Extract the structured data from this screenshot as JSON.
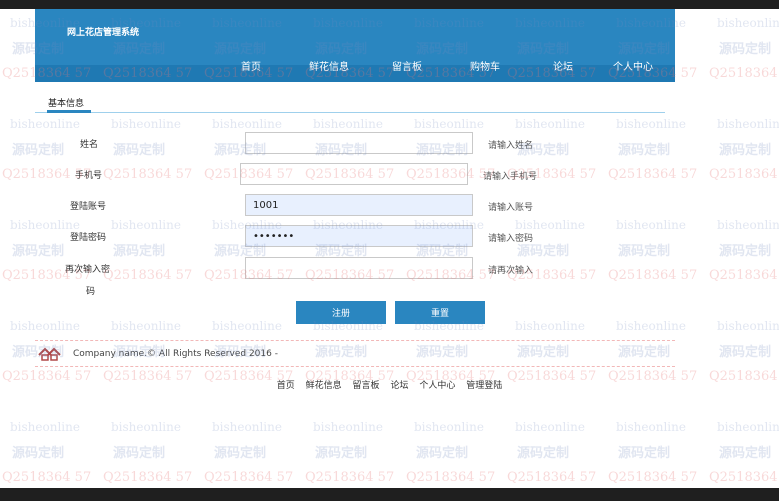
{
  "header": {
    "brand": "网上花店管理系统",
    "nav": [
      "首页",
      "鲜花信息",
      "留言板",
      "购物车",
      "论坛",
      "个人中心"
    ]
  },
  "tab": {
    "label": "基本信息"
  },
  "form": {
    "fields": [
      {
        "label": "姓名",
        "value": "",
        "hint": "请输入姓名"
      },
      {
        "label": "手机号",
        "value": "",
        "hint": "请输入手机号"
      },
      {
        "label": "登陆账号",
        "value": "1001",
        "hint": "请输入账号"
      },
      {
        "label": "登陆密码",
        "value": "•••••••",
        "hint": "请输入密码"
      },
      {
        "label": "再次输入密",
        "label2": "码",
        "value": "",
        "hint": "请再次输入"
      }
    ],
    "submit_label": "注册",
    "reset_label": "重置"
  },
  "footer": {
    "copyright": "Company name.© All Rights Reserved 2016 -",
    "links": [
      "首页",
      "鲜花信息",
      "留言板",
      "论坛",
      "个人中心",
      "管理登陆"
    ]
  },
  "watermark": {
    "line1": "bisheonline",
    "line2": "源码定制",
    "line3": "Q2518364 57"
  },
  "colors": {
    "header_bg": "#2a86c0",
    "nav_bg": "#1f79b3",
    "button_bg": "#2a86c0",
    "autofill_bg": "#e8f0fe"
  },
  "icons": {
    "footer_logo": "house-logo-icon"
  }
}
